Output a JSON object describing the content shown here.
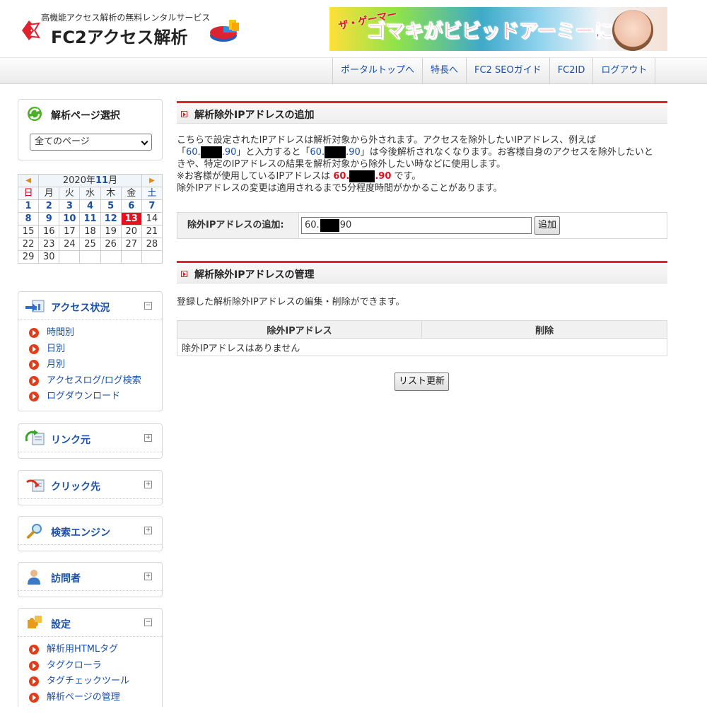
{
  "header": {
    "tagline": "高機能アクセス解析の無料レンタルサービス",
    "logo_text": "FC2アクセス解析",
    "banner": {
      "small": "ザ・ゲーマー",
      "text": "ゴマキがビビッドアーミーに参戦"
    }
  },
  "nav": [
    "ポータルトップへ",
    "特長へ",
    "FC2 SEOガイド",
    "FC2ID",
    "ログアウト"
  ],
  "sidebar": {
    "page_select": {
      "title": "解析ページ選択",
      "selected": "全てのページ"
    },
    "calendar": {
      "year_label": "2020年",
      "month": "11",
      "month_suffix": "月",
      "weekdays": [
        "日",
        "月",
        "火",
        "水",
        "木",
        "金",
        "土"
      ],
      "weeks": [
        [
          "1",
          "2",
          "3",
          "4",
          "5",
          "6",
          "7"
        ],
        [
          "8",
          "9",
          "10",
          "11",
          "12",
          "13",
          "14"
        ],
        [
          "15",
          "16",
          "17",
          "18",
          "19",
          "20",
          "21"
        ],
        [
          "22",
          "23",
          "24",
          "25",
          "26",
          "27",
          "28"
        ],
        [
          "29",
          "30",
          "",
          "",
          "",
          "",
          ""
        ]
      ],
      "today": "13"
    },
    "access": {
      "title": "アクセス状況",
      "toggle": "⊟",
      "items": [
        "時間別",
        "日別",
        "月別",
        "アクセスログ/ログ検索",
        "ログダウンロード"
      ]
    },
    "referrer": {
      "title": "リンク元",
      "toggle": "⊞"
    },
    "click": {
      "title": "クリック先",
      "toggle": "⊞"
    },
    "search": {
      "title": "検索エンジン",
      "toggle": "⊞"
    },
    "visitor": {
      "title": "訪問者",
      "toggle": "⊞"
    },
    "settings": {
      "title": "設定",
      "toggle": "⊟",
      "items": [
        "解析用HTMLタグ",
        "タグクローラ",
        "タグチェックツール",
        "解析ページの管理"
      ]
    }
  },
  "main": {
    "add_section": {
      "title": "解析除外IPアドレスの追加",
      "desc_1": "こちらで設定されたIPアドレスは解析対象から外されます。アクセスを除外したいIPアドレス、例えば",
      "ex_ip_a": "60.",
      "ex_ip_b": ".90",
      "desc_2": "」と入力すると「",
      "desc_3": "」は今後解析されなくなります。お客様自身のアクセスを除外したいと",
      "desc_4": "きや、特定のIPアドレスの結果を解析対象から除外したい時などに使用します。",
      "desc_5": "※お客様が使用しているIPアドレスは",
      "desc_6": "です。",
      "desc_7": "除外IPアドレスの変更は適用されるまで5分程度時間がかかることがあります。",
      "form_label": "除外IPアドレスの追加:",
      "input_a": "60.",
      "input_b": "90",
      "add_button": "追加"
    },
    "manage_section": {
      "title": "解析除外IPアドレスの管理",
      "desc": "登録した解析除外IPアドレスの編集・削除ができます。",
      "columns": [
        "除外IPアドレス",
        "削除"
      ],
      "empty_text": "除外IPアドレスはありません",
      "refresh_button": "リスト更新"
    }
  },
  "colors": {
    "accent_red": "#e0212e",
    "link_blue": "#1a4fa8",
    "today_red": "#e8101e"
  }
}
